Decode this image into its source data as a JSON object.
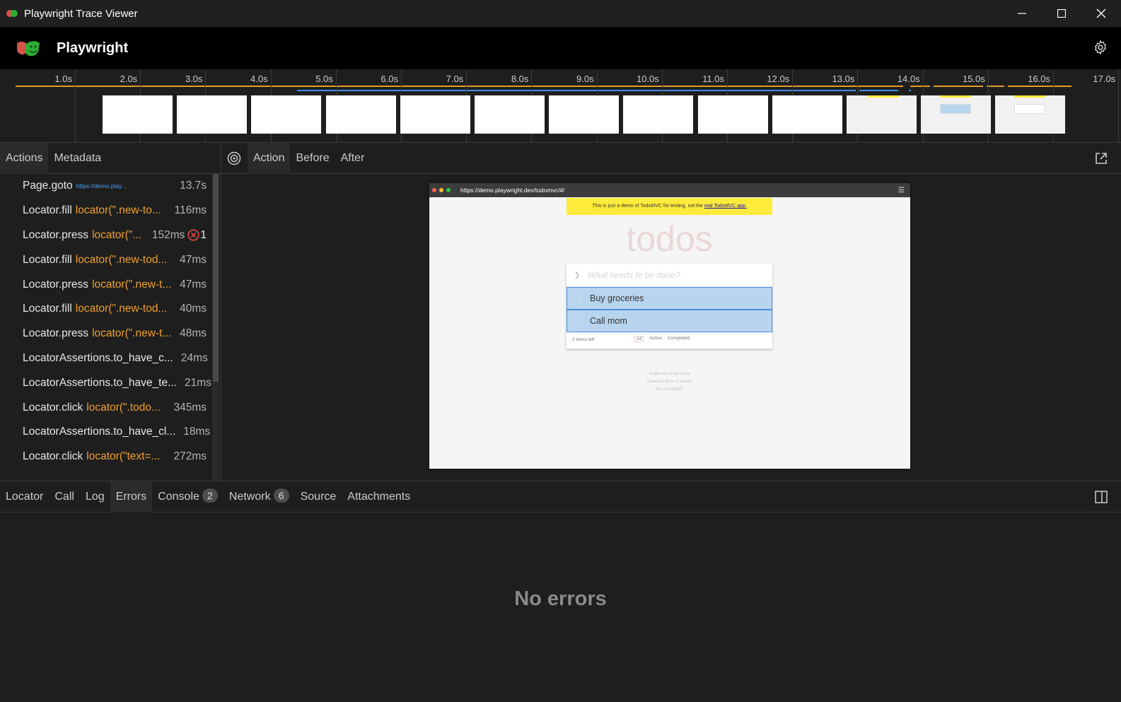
{
  "window": {
    "title": "Playwright Trace Viewer",
    "minimize_icon": "minimize-icon",
    "maximize_icon": "maximize-icon",
    "close_icon": "close-icon"
  },
  "header": {
    "brand": "Playwright",
    "settings_icon": "gear-icon"
  },
  "timeline": {
    "ticks": [
      "1.0s",
      "2.0s",
      "3.0s",
      "4.0s",
      "5.0s",
      "6.0s",
      "7.0s",
      "8.0s",
      "9.0s",
      "10.0s",
      "11.0s",
      "12.0s",
      "13.0s",
      "14.0s",
      "15.0s",
      "16.0s",
      "17.0s"
    ],
    "filmstrip_frames": 13
  },
  "sidebar": {
    "tabs": [
      "Actions",
      "Metadata"
    ],
    "active_tab": "Actions",
    "actions": [
      {
        "name": "Page.goto",
        "selector": "https://demo.play...",
        "type": "url",
        "duration": "13.7s"
      },
      {
        "name": "Locator.fill",
        "selector": "locator(\".new-to...",
        "type": "loc",
        "duration": "116ms"
      },
      {
        "name": "Locator.press",
        "selector": "locator(\"...",
        "type": "loc",
        "duration": "152ms",
        "errors": "1"
      },
      {
        "name": "Locator.fill",
        "selector": "locator(\".new-tod...",
        "type": "loc",
        "duration": "47ms"
      },
      {
        "name": "Locator.press",
        "selector": "locator(\".new-t...",
        "type": "loc",
        "duration": "47ms"
      },
      {
        "name": "Locator.fill",
        "selector": "locator(\".new-tod...",
        "type": "loc",
        "duration": "40ms"
      },
      {
        "name": "Locator.press",
        "selector": "locator(\".new-t...",
        "type": "loc",
        "duration": "48ms"
      },
      {
        "name": "LocatorAssertions.to_have_c...",
        "selector": "",
        "type": "loc",
        "duration": "24ms"
      },
      {
        "name": "LocatorAssertions.to_have_te...",
        "selector": "",
        "type": "loc",
        "duration": "21ms"
      },
      {
        "name": "Locator.click",
        "selector": "locator(\".todo...",
        "type": "loc",
        "duration": "345ms"
      },
      {
        "name": "LocatorAssertions.to_have_cl...",
        "selector": "",
        "type": "loc",
        "duration": "18ms"
      },
      {
        "name": "Locator.click",
        "selector": "locator(\"text=...",
        "type": "loc",
        "duration": "272ms"
      }
    ]
  },
  "snapshot": {
    "tabs": [
      "Action",
      "Before",
      "After"
    ],
    "target_icon": "target-icon",
    "popout_icon": "external-link-icon",
    "browser": {
      "url": "https://demo.playwright.dev/todomvc/#/",
      "banner_text": "This is just a demo of TodoMVC for testing, not the ",
      "banner_link": "real TodoMVC app.",
      "heading": "todos",
      "placeholder": "What needs to be done?",
      "items": [
        "Buy groceries",
        "Call mom"
      ],
      "items_left": "2 items left",
      "filters": [
        "All",
        "Active",
        "Completed"
      ],
      "info": [
        "Double-click to edit a todo",
        "Created by Remo H. Jansen",
        "Part of TodoMVC"
      ]
    }
  },
  "bottom": {
    "tabs": [
      {
        "label": "Locator"
      },
      {
        "label": "Call"
      },
      {
        "label": "Log"
      },
      {
        "label": "Errors"
      },
      {
        "label": "Console",
        "badge": "2"
      },
      {
        "label": "Network",
        "badge": "6"
      },
      {
        "label": "Source"
      },
      {
        "label": "Attachments"
      }
    ],
    "active_tab": "Errors",
    "empty_message": "No errors",
    "layout_icon": "sidebar-toggle-icon"
  },
  "colors": {
    "url": "#4aa3ff",
    "locator": "#f0a030",
    "error": "#f14c4c",
    "timeline_orange": "#e89a2c",
    "timeline_blue": "#3b8eea"
  }
}
